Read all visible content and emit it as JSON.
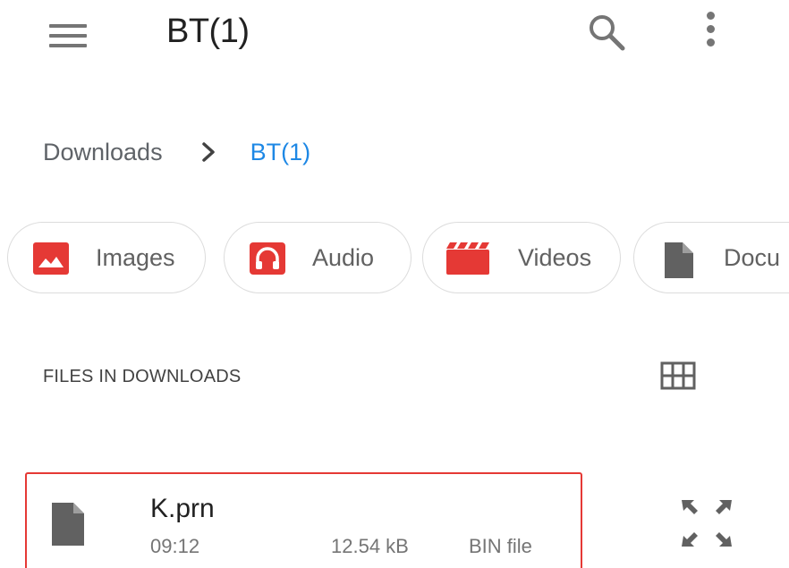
{
  "topbar": {
    "title": "BT(1)",
    "menu_icon": "menu-icon",
    "search_icon": "search-icon",
    "more_icon": "more-vert-icon"
  },
  "breadcrumb": {
    "items": [
      "Downloads",
      "BT(1)"
    ],
    "separator_icon": "chevron-right-icon"
  },
  "categories": [
    {
      "label": "Images",
      "icon": "image-icon",
      "color": "#e53935"
    },
    {
      "label": "Audio",
      "icon": "headphones-icon",
      "color": "#e53935"
    },
    {
      "label": "Videos",
      "icon": "video-clapper-icon",
      "color": "#e53935"
    },
    {
      "label": "Docu",
      "icon": "document-icon",
      "color": "#616161"
    }
  ],
  "section": {
    "title": "FILES IN DOWNLOADS",
    "view_toggle_icon": "grid-view-icon"
  },
  "files": [
    {
      "name": "K.prn",
      "time": "09:12",
      "size": "12.54 kB",
      "type": "BIN file",
      "icon": "file-icon",
      "selected": true
    }
  ],
  "expand_icon": "expand-icon",
  "colors": {
    "accent": "#1e88e5",
    "selection_border": "#e53935",
    "category_red": "#e53935"
  }
}
